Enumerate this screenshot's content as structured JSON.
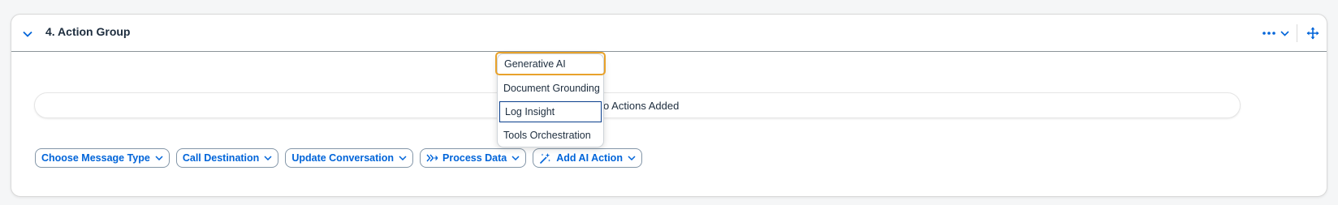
{
  "panel": {
    "title": "4. Action Group",
    "collapse_icon": "chevron-down-icon",
    "more_icon": "overflow-icon",
    "move_icon": "move-arrows-icon"
  },
  "empty_state": {
    "text": "No Actions Added"
  },
  "toolbar": {
    "buttons": [
      {
        "label": "Choose Message Type",
        "icon": null
      },
      {
        "label": "Call Destination",
        "icon": null
      },
      {
        "label": "Update Conversation",
        "icon": null
      },
      {
        "label": "Process Data",
        "icon": "process-icon"
      },
      {
        "label": "Add AI Action",
        "icon": "ai-sparkle-icon"
      }
    ]
  },
  "dropdown": {
    "items": [
      {
        "label": "Generative AI",
        "state": "focused"
      },
      {
        "label": "Document Grounding",
        "state": ""
      },
      {
        "label": "Log Insight",
        "state": "selected"
      },
      {
        "label": "Tools Orchestration",
        "state": ""
      }
    ]
  },
  "colors": {
    "accent": "#0064d9",
    "focus": "#e8a22b",
    "text": "#1d2d3e"
  }
}
